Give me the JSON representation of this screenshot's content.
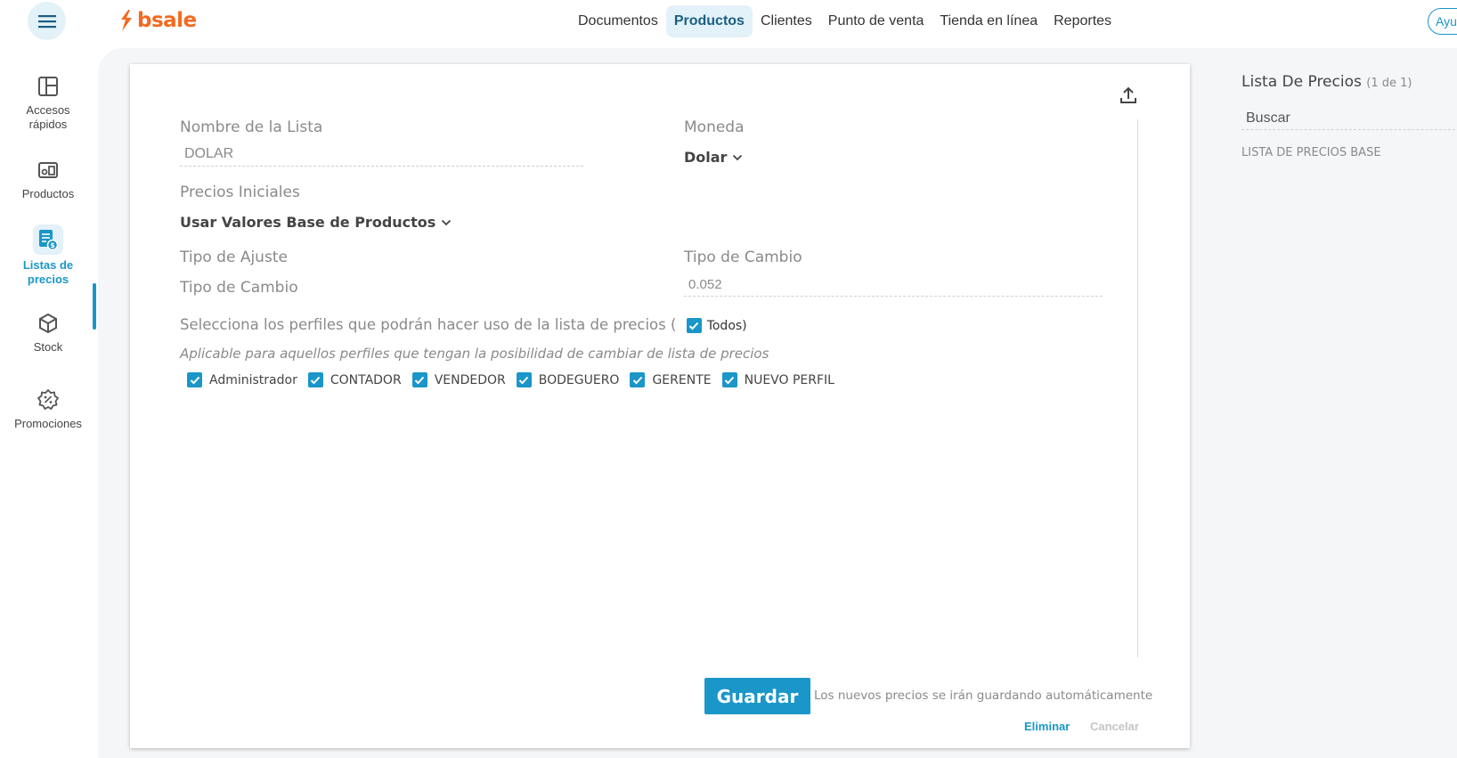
{
  "brand": {
    "name": "bsale",
    "color": "#f26a21"
  },
  "accent": "#1a96c8",
  "topnav": {
    "items": [
      {
        "label": "Documentos"
      },
      {
        "label": "Productos",
        "active": true
      },
      {
        "label": "Clientes"
      },
      {
        "label": "Punto de venta"
      },
      {
        "label": "Tienda en línea"
      },
      {
        "label": "Reportes"
      }
    ],
    "help_label": "Ayu"
  },
  "sidebar": {
    "items": [
      {
        "label1": "Accesos",
        "label2": "rápidos",
        "icon": "quick-access-icon"
      },
      {
        "label1": "Productos",
        "label2": "",
        "icon": "products-icon"
      },
      {
        "label1": "Listas de",
        "label2": "precios",
        "icon": "price-list-icon",
        "active": true
      },
      {
        "label1": "Stock",
        "label2": "",
        "icon": "stock-box-icon"
      },
      {
        "label1": "Promociones",
        "label2": "",
        "icon": "promotions-icon"
      }
    ]
  },
  "form": {
    "list_name_label": "Nombre de la Lista",
    "list_name_value": "DOLAR",
    "currency_label": "Moneda",
    "currency_value": "Dolar",
    "initial_prices_label": "Precios Iniciales",
    "initial_prices_value": "Usar Valores Base de Productos",
    "adjust_type_label": "Tipo de Ajuste",
    "exchange_type_label_left": "Tipo de Cambio",
    "exchange_type_label_right": "Tipo de Cambio",
    "exchange_value": "0.052",
    "profiles_prompt": "Selecciona los perfiles que podrán hacer uso de la lista de precios (",
    "profiles_all": "Todos",
    "profiles_close": ")",
    "profiles_note": "Aplicable para aquellos perfiles que tengan la posibilidad de cambiar de lista de precios",
    "profiles": [
      {
        "label": "Administrador",
        "checked": true
      },
      {
        "label": "CONTADOR",
        "checked": true
      },
      {
        "label": "VENDEDOR",
        "checked": true
      },
      {
        "label": "BODEGUERO",
        "checked": true
      },
      {
        "label": "GERENTE",
        "checked": true
      },
      {
        "label": "NUEVO PERFIL",
        "checked": true
      }
    ],
    "save_label": "Guardar",
    "save_note": "Los nuevos precios se irán guardando automáticamente",
    "delete_label": "Eliminar",
    "cancel_label": "Cancelar"
  },
  "right_panel": {
    "title": "Lista De Precios",
    "count": "(1 de 1)",
    "search_placeholder": "Buscar",
    "base_label": "LISTA DE PRECIOS BASE"
  }
}
